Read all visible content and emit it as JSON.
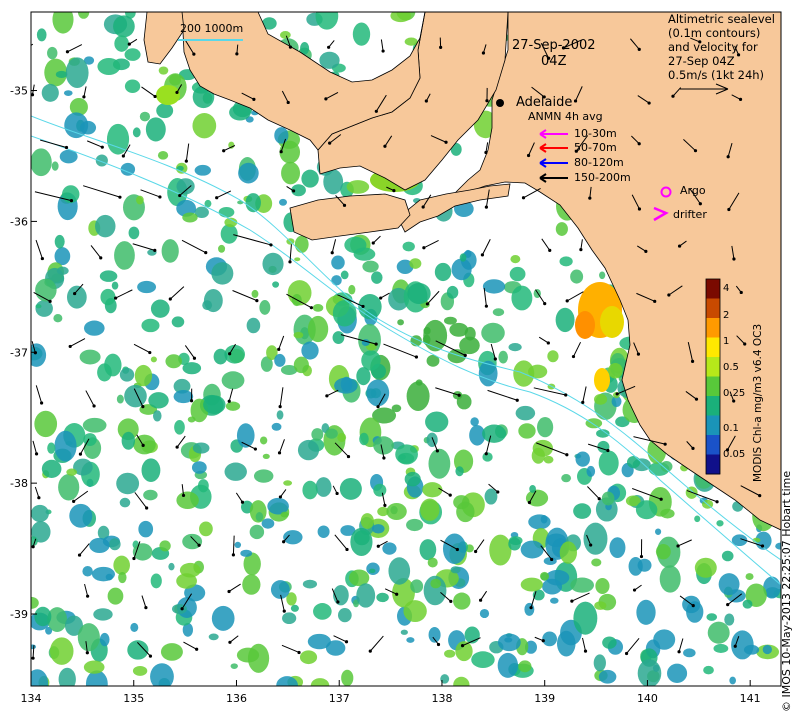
{
  "title": {
    "date": "27-Sep-2002",
    "time": "04Z"
  },
  "info_lines": [
    "Altimetric sealevel",
    "(0.1m contours)",
    "and velocity for",
    "27-Sep 04Z",
    "0.5m/s (1kt 24h)"
  ],
  "scale_bar": {
    "label": "200  1000m"
  },
  "city": {
    "name": "Adelaide",
    "lon": 138.6,
    "lat": -34.93
  },
  "anmn": {
    "title": "ANMN 4h avg",
    "entries": [
      {
        "label": "10-30m",
        "color": "#ff00ff"
      },
      {
        "label": "50-70m",
        "color": "#ff0000"
      },
      {
        "label": "80-120m",
        "color": "#0000ff"
      },
      {
        "label": "150-200m",
        "color": "#000000"
      }
    ]
  },
  "markers": {
    "argo": {
      "label": "Argo",
      "color": "#ff00ff"
    },
    "drifter": {
      "label": "drifter",
      "color": "#ff00ff"
    }
  },
  "colorbar": {
    "label": "MODIS Chl-a mg/m3 v6.4 OC3",
    "ticks": [
      "4",
      "2",
      "1",
      "0.5",
      "0.25",
      "0.1",
      "0.05"
    ],
    "colors": [
      "#7a0a00",
      "#c84a00",
      "#ff9a00",
      "#ffe800",
      "#b6e81a",
      "#58c83a",
      "#1ab07a",
      "#1a94b8",
      "#1a52c8",
      "#10108a"
    ]
  },
  "credit": "© IMOS 10-May-2013 22:25:07 Hobart time",
  "axes": {
    "x_ticks": [
      "134",
      "135",
      "136",
      "137",
      "138",
      "139",
      "140",
      "141"
    ],
    "y_ticks": [
      "-35",
      "-36",
      "-37",
      "-38",
      "-39"
    ],
    "xlim": [
      134,
      141.3
    ],
    "ylim": [
      -39.55,
      -34.4
    ]
  },
  "colors": {
    "land": "#f7c89a",
    "coast": "#000000",
    "bathy": "#5ad8e8",
    "chl_low": "#1ab07a",
    "chl_mid": "#58c83a"
  }
}
